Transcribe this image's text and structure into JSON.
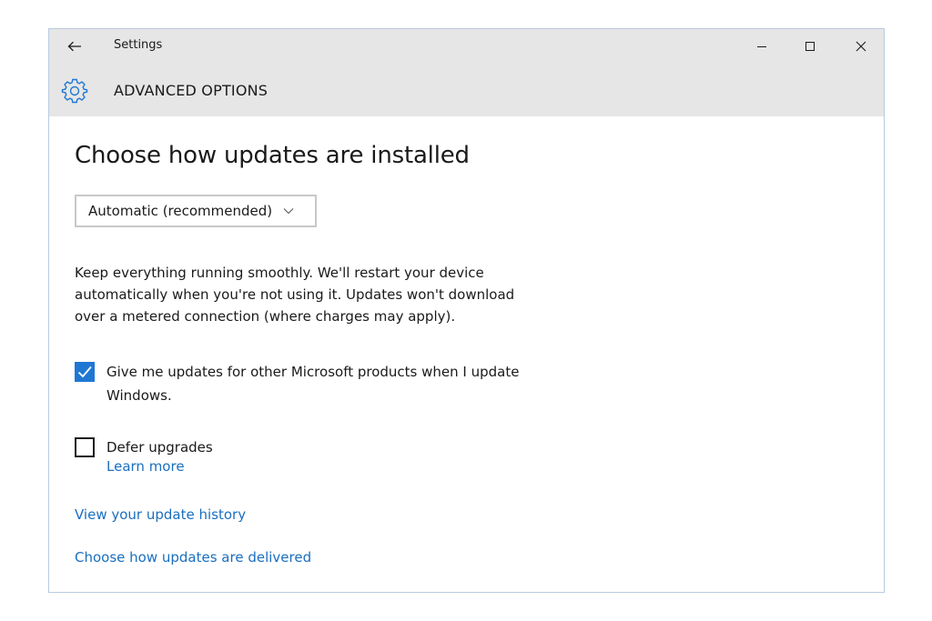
{
  "window": {
    "app_title": "Settings",
    "page_title": "ADVANCED OPTIONS",
    "accent_color": "#1f77d4",
    "link_color": "#1a6fbf",
    "icons": {
      "back": "back-arrow-icon",
      "minimize": "minimize-icon",
      "maximize": "maximize-icon",
      "close": "close-icon",
      "header": "gear-icon"
    }
  },
  "content": {
    "heading": "Choose how updates are installed",
    "dropdown": {
      "selected": "Automatic (recommended)"
    },
    "description_lines": [
      "Keep everything running smoothly. We'll restart your device",
      "automatically when you're not using it. Updates won't download",
      "over a metered connection (where charges may apply)."
    ],
    "options": [
      {
        "label_lines": [
          "Give me updates for other Microsoft products when I update",
          "Windows."
        ],
        "checked": true
      },
      {
        "label_lines": [
          "Defer upgrades"
        ],
        "checked": false,
        "link": "Learn more"
      }
    ],
    "links": {
      "history": "View your update history",
      "delivered": "Choose how updates are delivered"
    }
  }
}
